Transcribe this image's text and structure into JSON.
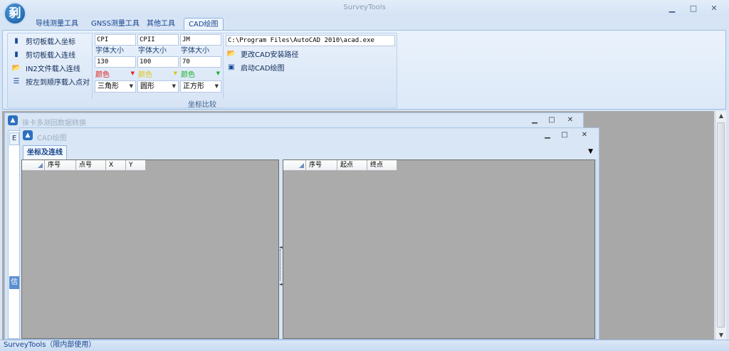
{
  "app": {
    "title": "SurveyTools",
    "logo_text": "剢"
  },
  "window_controls": {
    "minimize": "▁",
    "maximize": "□",
    "close": "✕"
  },
  "tabs": [
    {
      "label": "导线测量工具"
    },
    {
      "label": "GNSS测量工具"
    },
    {
      "label": "其他工具"
    },
    {
      "label": "CAD绘图"
    }
  ],
  "ribbon": {
    "group_label": "坐标比较",
    "load_buttons": [
      {
        "label": "剪切板载入坐标",
        "icon": "document-icon"
      },
      {
        "label": "剪切板载入连线",
        "icon": "document-icon"
      },
      {
        "label": "IN2文件载入连线",
        "icon": "folder-open-icon"
      },
      {
        "label": "按左到顺序载入点对",
        "icon": "list-icon"
      }
    ],
    "columns": [
      {
        "name_value": "CPI",
        "font_label": "字体大小",
        "font_size": "130",
        "color_label": "颜色",
        "color": "#e02020",
        "shape": "三角形"
      },
      {
        "name_value": "CPII",
        "font_label": "字体大小",
        "font_size": "100",
        "color_label": "颜色",
        "color": "#e0d020",
        "shape": "圆形"
      },
      {
        "name_value": "JM",
        "font_label": "字体大小",
        "font_size": "70",
        "color_label": "颜色",
        "color": "#20b030",
        "shape": "正方形"
      }
    ],
    "cad": {
      "path": "C:\\Program Files\\AutoCAD 2010\\acad.exe",
      "change_path_label": "更改CAD安装路径",
      "launch_label": "启动CAD绘图"
    }
  },
  "child_window_1": {
    "title": "徕卡多测回数据转换",
    "tab_label": "E",
    "info_label": "信"
  },
  "child_window_2": {
    "title": "CAD绘图",
    "tab": "坐标及连线",
    "left_grid_headers": [
      "序号",
      "点号",
      "X",
      "Y"
    ],
    "right_grid_headers": [
      "序号",
      "起点",
      "终点"
    ]
  },
  "status_bar": {
    "text": "SurveyTools（限内部使用）"
  }
}
